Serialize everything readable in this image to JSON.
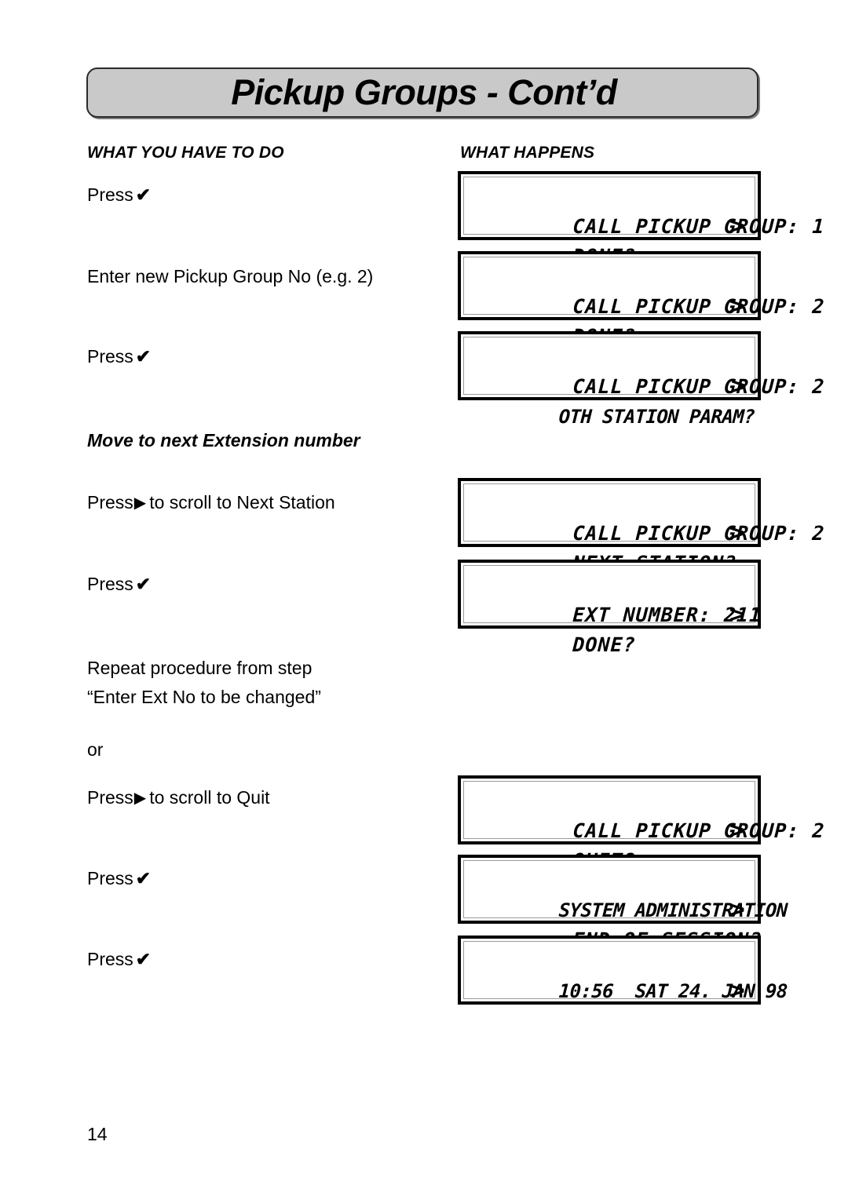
{
  "page": {
    "title": "Pickup Groups - Cont’d",
    "number": "14"
  },
  "columns": {
    "left_heading": "WHAT YOU HAVE TO DO",
    "right_heading": "WHAT HAPPENS"
  },
  "section_heading": "Move to next Extension number",
  "icons": {
    "check": "✔",
    "right_arrow": "▶",
    "caret": ">"
  },
  "steps": [
    {
      "action_prefix": "Press",
      "action_icon": "check",
      "action_suffix": "",
      "lcd": {
        "line1": "CALL PICKUP GROUP: 1",
        "line2": "DONE?",
        "caret": ">"
      }
    },
    {
      "action_prefix": "Enter new Pickup Group No (e.g. 2)",
      "action_icon": "",
      "action_suffix": "",
      "lcd": {
        "line1": "CALL PICKUP GROUP: 2",
        "line2": "DONE?",
        "caret": ">"
      }
    },
    {
      "action_prefix": "Press",
      "action_icon": "check",
      "action_suffix": "",
      "lcd": {
        "line1": "CALL PICKUP GROUP: 2",
        "line2": "OTH STATION PARAM?",
        "caret": ">"
      }
    },
    {
      "action_prefix": "Press",
      "action_icon": "right_arrow",
      "action_suffix": "to scroll to Next Station",
      "lcd": {
        "line1": "CALL PICKUP GROUP: 2",
        "line2": "NEXT STATION?",
        "caret": ">"
      }
    },
    {
      "action_prefix": "Press",
      "action_icon": "check",
      "action_suffix": "",
      "lcd": {
        "line1": "EXT NUMBER: 211",
        "line2": "DONE?",
        "caret": ">"
      }
    },
    {
      "action_prefix": "Press",
      "action_icon": "right_arrow",
      "action_suffix": "to scroll to Quit",
      "lcd": {
        "line1": "CALL PICKUP GROUP: 2",
        "line2": "QUIT?",
        "caret": ">"
      }
    },
    {
      "action_prefix": "Press",
      "action_icon": "check",
      "action_suffix": "",
      "lcd": {
        "line1": "SYSTEM ADMINISTRATION",
        "line2": "END OF SESSION?",
        "caret": ">"
      }
    },
    {
      "action_prefix": "Press",
      "action_icon": "check",
      "action_suffix": "",
      "lcd": {
        "line1": "10:56  SAT 24. JAN 98",
        "line2": "",
        "caret": ">"
      }
    }
  ],
  "notes": {
    "repeat_line1": "Repeat procedure from step",
    "repeat_line2": "“Enter Ext No to be changed”",
    "or": "or"
  }
}
